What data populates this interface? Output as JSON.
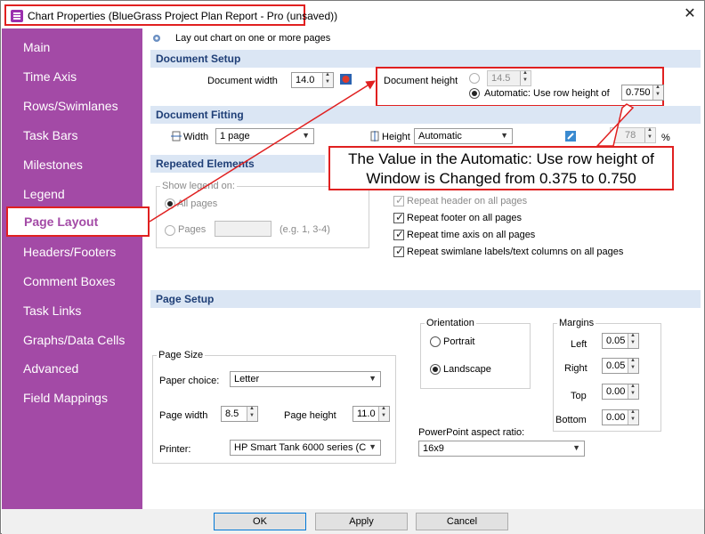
{
  "window": {
    "title": "Chart Properties (BlueGrass Project Plan Report - Pro (unsaved))",
    "close_glyph": "✕"
  },
  "sidebar": {
    "items": [
      {
        "label": "Main"
      },
      {
        "label": "Time Axis"
      },
      {
        "label": "Rows/Swimlanes"
      },
      {
        "label": "Task Bars"
      },
      {
        "label": "Milestones"
      },
      {
        "label": "Legend"
      },
      {
        "label": "Page Layout",
        "active": true
      },
      {
        "label": "Headers/Footers"
      },
      {
        "label": "Comment Boxes"
      },
      {
        "label": "Task Links"
      },
      {
        "label": "Graphs/Data Cells"
      },
      {
        "label": "Advanced"
      },
      {
        "label": "Field Mappings"
      }
    ]
  },
  "header": {
    "subtitle": "Lay out chart on one or more pages"
  },
  "document_setup": {
    "title": "Document Setup",
    "width_label": "Document width",
    "width_value": "14.0",
    "height_label": "Document height",
    "height_value": "14.5",
    "automatic_label": "Automatic: Use row height of",
    "row_height_value": "0.750"
  },
  "document_fitting": {
    "title": "Document Fitting",
    "width_label": "Width",
    "width_value": "1 page",
    "height_label": "Height",
    "height_value": "Automatic",
    "scale_value": "78",
    "scale_unit": "%"
  },
  "repeated_elements": {
    "title": "Repeated Elements",
    "show_legend_on": "Show legend on:",
    "all_pages": "All pages",
    "pages": "Pages",
    "pages_hint": "(e.g. 1, 3-4)",
    "checks": [
      {
        "label": "Repeat header on all pages",
        "checked": true,
        "disabled": true
      },
      {
        "label": "Repeat footer on all pages",
        "checked": true
      },
      {
        "label": "Repeat time axis on all pages",
        "checked": true
      },
      {
        "label": "Repeat swimlane labels/text columns on all pages",
        "checked": true
      }
    ]
  },
  "callout": {
    "line1": "The Value in the Automatic: Use row height of",
    "line2": "Window is Changed from 0.375 to 0.750"
  },
  "page_setup": {
    "title": "Page Setup",
    "page_size_title": "Page Size",
    "paper_choice_label": "Paper choice:",
    "paper_choice_value": "Letter",
    "page_width_label": "Page width",
    "page_width_value": "8.5",
    "page_height_label": "Page height",
    "page_height_value": "11.0",
    "printer_label": "Printer:",
    "printer_value": "HP Smart Tank 6000 series (C",
    "orientation_title": "Orientation",
    "portrait": "Portrait",
    "landscape": "Landscape",
    "ppt_ratio_label": "PowerPoint aspect ratio:",
    "ppt_ratio_value": "16x9",
    "margins_title": "Margins",
    "margin_left_label": "Left",
    "margin_left_value": "0.05",
    "margin_right_label": "Right",
    "margin_right_value": "0.05",
    "margin_top_label": "Top",
    "margin_top_value": "0.00",
    "margin_bottom_label": "Bottom",
    "margin_bottom_value": "0.00"
  },
  "buttons": {
    "ok": "OK",
    "apply": "Apply",
    "cancel": "Cancel"
  },
  "colors": {
    "sidebar": "#a34aa6",
    "section_bar": "#dbe6f4",
    "highlight": "#e02020"
  }
}
